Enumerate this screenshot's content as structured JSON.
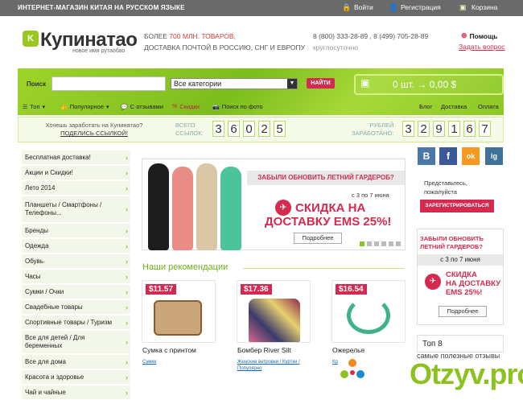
{
  "topbar": {
    "tagline": "ИНТЕРНЕТ-МАГАЗИН КИТАЯ НА РУССКОМ ЯЗЫКЕ",
    "login": "Войти",
    "register": "Регистрация",
    "cart": "Корзина"
  },
  "header": {
    "logo": "Купинатао",
    "logo_mark": "K",
    "logo_sub": "новое имя рутаобао",
    "goods_prefix": "БОЛЕЕ ",
    "goods_count": "700 МЛН. ТОВАРОВ,",
    "delivery": "ДОСТАВКА ПОЧТОЙ В РОССИЮ, СНГ И ЕВРОПУ",
    "phones": "8 (800) 333-28-89 , 8 (499) 705-28-89",
    "hours": "круглосуточно",
    "help": "Помощь",
    "ask": "Задать вопрос"
  },
  "search": {
    "label": "Поиск",
    "placeholder": "",
    "category": "Все категории",
    "button": "НАЙТИ"
  },
  "cart": {
    "summary": "0 шт.  →  0,00 $"
  },
  "nav": {
    "top": "Топ",
    "popular": "Популярное",
    "reviews": "С отзывами",
    "discounts": "Скидки",
    "photo_search": "Поиск по фото",
    "blog": "Блог",
    "delivery": "Доставка",
    "payment": "Оплата"
  },
  "counter": {
    "earn_question": "Хочешь заработать на Купинатао?",
    "share_link": "ПОДЕЛИСЬ ССЫЛКОЙ!",
    "links_label_1": "ВСЕГО",
    "links_label_2": "ССЫЛОК:",
    "links_digits": [
      "3",
      "6",
      "0",
      "2",
      "5"
    ],
    "rubles_label_1": "РУБЛЕЙ",
    "rubles_label_2": "ЗАРАБОТАНО:",
    "rubles_digits": [
      "3",
      "2",
      "9",
      "1",
      "6",
      "7"
    ]
  },
  "sidebar": {
    "items": [
      "Бесплатная доставка!",
      "Акции и Скидки!",
      "Лето 2014",
      "Планшеты / Смартфоны / Телефоны...",
      "Бренды",
      "Одежда",
      "Обувь",
      "Часы",
      "Сумки / Очки",
      "Свадебные товары",
      "Спортивные товары / Туризм",
      "Все для детей / Для беременных",
      "Все для дома",
      "Красота и здоровье",
      "Чай и чайные"
    ]
  },
  "banner": {
    "forgot": "ЗАБЫЛИ ОБНОВИТЬ ЛЕТНИЙ ГАРДЕРОБ?",
    "dates": "с 3 по 7 июня",
    "discount_line1": "СКИДКА НА",
    "discount_line2": "ДОСТАВКУ EMS 25%!",
    "more": "Подробнее"
  },
  "recommendations": {
    "title": "Наши рекомендации",
    "products": [
      {
        "price": "$11.57",
        "name": "Сумка с принтом",
        "category": "Сумки"
      },
      {
        "price": "$17.36",
        "name": "Бомбер River Silt",
        "category": "Женские ветровки / Куртки / Популярно"
      },
      {
        "price": "$16.54",
        "name": "Ожерелье",
        "category": "Кр"
      }
    ]
  },
  "right": {
    "social": [
      "В",
      "f",
      "ok",
      "ig"
    ],
    "intro_1": "Представьтесь,",
    "intro_2": "пожалуйста",
    "register_button": "ЗАРЕГИСТРИРОВАТЬСЯ",
    "banner_forgot_1": "ЗАБЫЛИ ОБНОВИТЬ",
    "banner_forgot_2": "ЛЕТНИЙ ГАРДЕРОБ?",
    "banner_dates": "с 3 по 7 июня",
    "banner_discount_1": "СКИДКА",
    "banner_discount_2": "НА ДОСТАВКУ",
    "banner_discount_3": "EMS 25%!",
    "banner_more": "Подробнее",
    "top8": "Топ 8"
  },
  "watermark": {
    "sub": "самые полезные отзывы",
    "text": "Otzyv.pro"
  },
  "colors": {
    "brand_green": "#8bc220",
    "accent_red": "#d52a4f",
    "topbar": "#6a6a6a"
  }
}
